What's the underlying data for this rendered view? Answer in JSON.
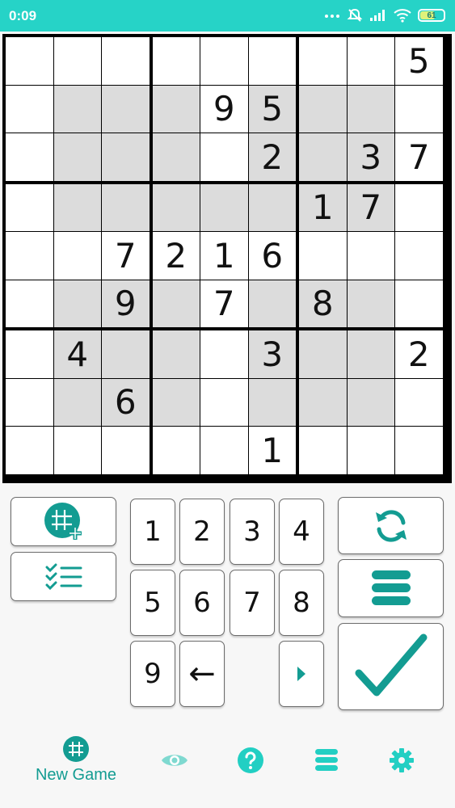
{
  "status_bar": {
    "time": "0:09",
    "battery": "61"
  },
  "board": {
    "rows": [
      [
        "",
        "",
        "",
        "",
        "",
        "",
        "",
        "",
        "5"
      ],
      [
        "",
        "",
        "",
        "",
        "9",
        "5",
        "",
        "",
        ""
      ],
      [
        "",
        "",
        "",
        "",
        "",
        "2",
        "",
        "3",
        "7"
      ],
      [
        "",
        "",
        "",
        "",
        "",
        "",
        "1",
        "7",
        ""
      ],
      [
        "",
        "",
        "7",
        "2",
        "1",
        "6",
        "",
        "",
        ""
      ],
      [
        "",
        "",
        "9",
        "",
        "7",
        "",
        "8",
        "",
        ""
      ],
      [
        "",
        "4",
        "",
        "",
        "",
        "3",
        "",
        "",
        "2"
      ],
      [
        "",
        "",
        "6",
        "",
        "",
        "",
        "",
        "",
        ""
      ],
      [
        "",
        "",
        "",
        "",
        "",
        "1",
        "",
        "",
        ""
      ]
    ],
    "shaded": [
      [
        1,
        1
      ],
      [
        1,
        2
      ],
      [
        1,
        3
      ],
      [
        1,
        5
      ],
      [
        1,
        6
      ],
      [
        1,
        7
      ],
      [
        2,
        1
      ],
      [
        2,
        2
      ],
      [
        2,
        3
      ],
      [
        2,
        5
      ],
      [
        2,
        6
      ],
      [
        2,
        7
      ],
      [
        3,
        1
      ],
      [
        3,
        2
      ],
      [
        3,
        3
      ],
      [
        3,
        4
      ],
      [
        3,
        5
      ],
      [
        3,
        6
      ],
      [
        3,
        7
      ],
      [
        5,
        1
      ],
      [
        5,
        2
      ],
      [
        5,
        3
      ],
      [
        5,
        5
      ],
      [
        5,
        6
      ],
      [
        5,
        7
      ],
      [
        6,
        1
      ],
      [
        6,
        2
      ],
      [
        6,
        3
      ],
      [
        6,
        5
      ],
      [
        6,
        6
      ],
      [
        6,
        7
      ],
      [
        7,
        1
      ],
      [
        7,
        2
      ],
      [
        7,
        3
      ],
      [
        7,
        5
      ],
      [
        7,
        6
      ],
      [
        7,
        7
      ]
    ]
  },
  "keypad": {
    "digits": [
      "1",
      "2",
      "3",
      "4",
      "5",
      "6",
      "7",
      "8",
      "9"
    ],
    "backspace": "←"
  },
  "bottom_nav": {
    "new_game_label": "New Game"
  },
  "colors": {
    "accent": "#26d3c7",
    "icon": "#139c92",
    "shade": "#dcdcdc"
  }
}
